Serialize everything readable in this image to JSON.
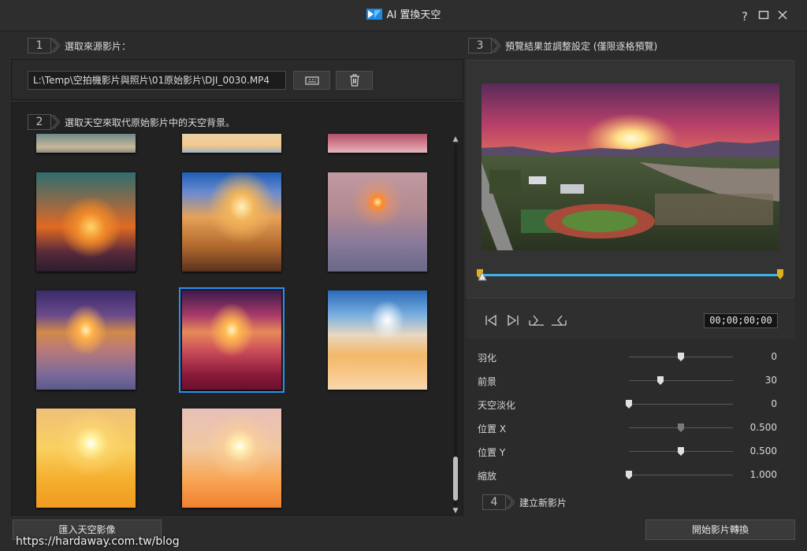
{
  "window": {
    "title": "AI 置換天空"
  },
  "steps": {
    "step1": {
      "number": "1",
      "label": "選取來源影片："
    },
    "step2": {
      "number": "2",
      "label": "選取天空來取代原始影片中的天空背景。"
    },
    "step3": {
      "number": "3",
      "label": "預覽結果並調整設定 (僅限逐格預覽)"
    },
    "step4": {
      "number": "4",
      "label": "建立新影片"
    }
  },
  "source": {
    "path": "L:\\Temp\\空拍機影片與照片\\01原始影片\\DJI_0030.MP4"
  },
  "sky_library": {
    "selected_index": 7,
    "count_visible": 11
  },
  "playback": {
    "timecode": "00;00;00;00",
    "progress": 0.0
  },
  "settings": [
    {
      "label": "羽化",
      "value": "0",
      "level": 0.5
    },
    {
      "label": "前景",
      "value": "30",
      "level": 0.3
    },
    {
      "label": "天空淡化",
      "value": "0",
      "level": 0.0
    },
    {
      "label": "位置 X",
      "value": "0.500",
      "level": 0.5,
      "disabled": true
    },
    {
      "label": "位置 Y",
      "value": "0.500",
      "level": 0.5
    },
    {
      "label": "縮放",
      "value": "1.000",
      "level": 0.0
    }
  ],
  "buttons": {
    "import_sky": "匯入天空影像",
    "start_convert": "開始影片轉換"
  },
  "watermark": "https://hardaway.com.tw/blog",
  "colors": {
    "accent": "#2a8df5",
    "timeline": "#3fb0e8",
    "marker": "#e0b020"
  }
}
